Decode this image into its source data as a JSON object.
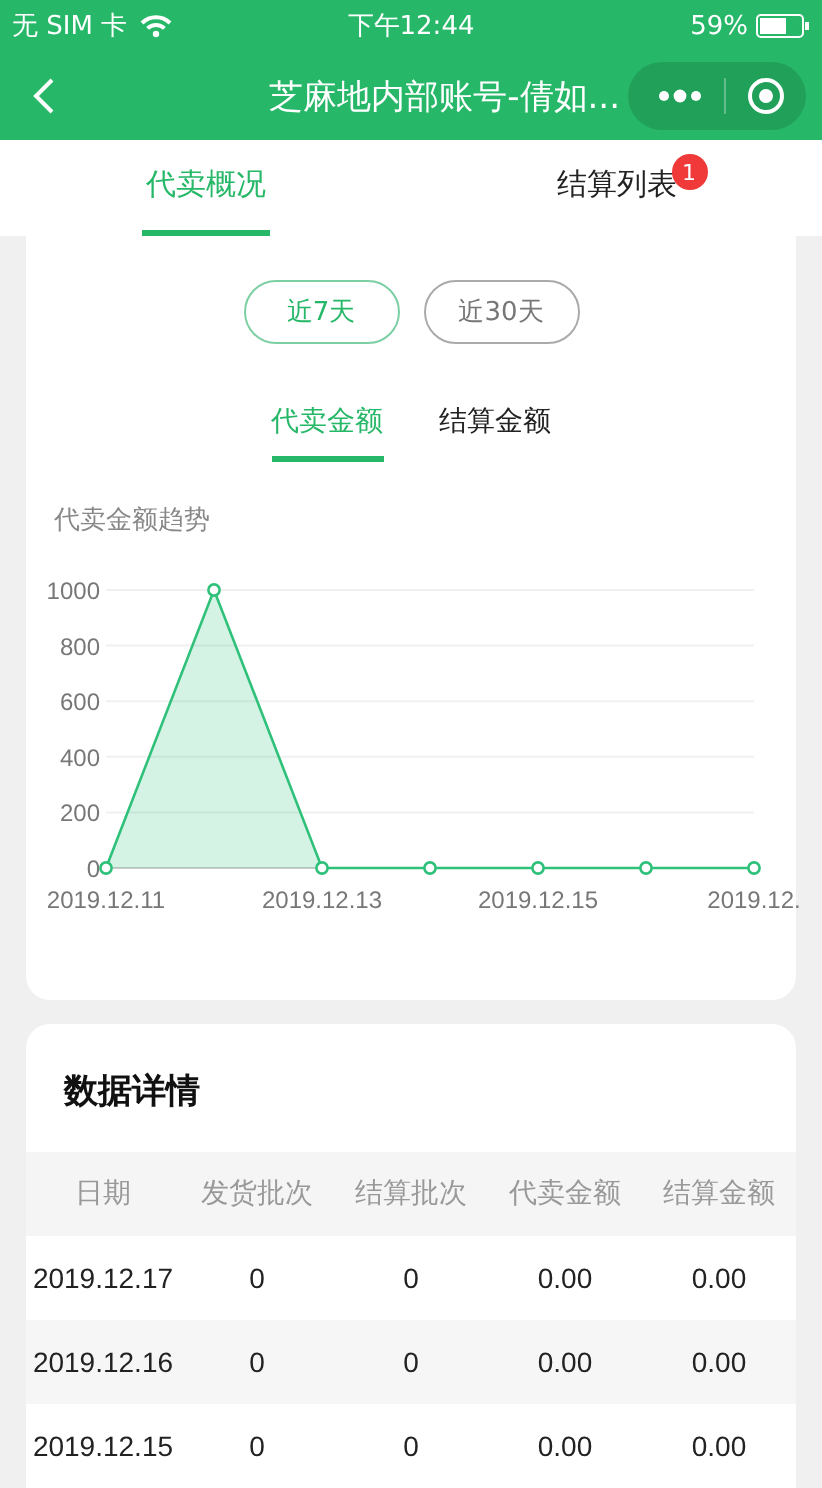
{
  "status_bar": {
    "carrier": "无 SIM 卡",
    "time": "下午12:44",
    "battery": "59%"
  },
  "nav_bar": {
    "title": "芝麻地内部账号-倩如..."
  },
  "tabs": [
    {
      "label": "代卖概况",
      "selected": true
    },
    {
      "label": "结算列表",
      "selected": false,
      "badge": "1"
    }
  ],
  "range_buttons": [
    {
      "label": "近7天",
      "selected": true
    },
    {
      "label": "近30天",
      "selected": false
    }
  ],
  "metric_tabs": [
    {
      "label": "代卖金额",
      "selected": true
    },
    {
      "label": "结算金额",
      "selected": false
    }
  ],
  "chart_title": "代卖金额趋势",
  "chart_data": {
    "type": "area",
    "categories": [
      "2019.12.11",
      null,
      "2019.12.13",
      null,
      "2019.12.15",
      null,
      "2019.12."
    ],
    "series": [
      {
        "color": "#2fc17a",
        "values": [
          0,
          1000,
          0,
          0,
          0,
          0,
          0
        ]
      }
    ],
    "ylim": [
      0,
      1000
    ],
    "yticks": [
      0,
      200,
      400,
      600,
      800,
      1000
    ],
    "grid": true
  },
  "details": {
    "title": "数据详情",
    "columns": [
      "日期",
      "发货批次",
      "结算批次",
      "代卖金额",
      "结算金额"
    ],
    "rows": [
      [
        "2019.12.17",
        "0",
        "0",
        "0.00",
        "0.00"
      ],
      [
        "2019.12.16",
        "0",
        "0",
        "0.00",
        "0.00"
      ],
      [
        "2019.12.15",
        "0",
        "0",
        "0.00",
        "0.00"
      ]
    ]
  }
}
